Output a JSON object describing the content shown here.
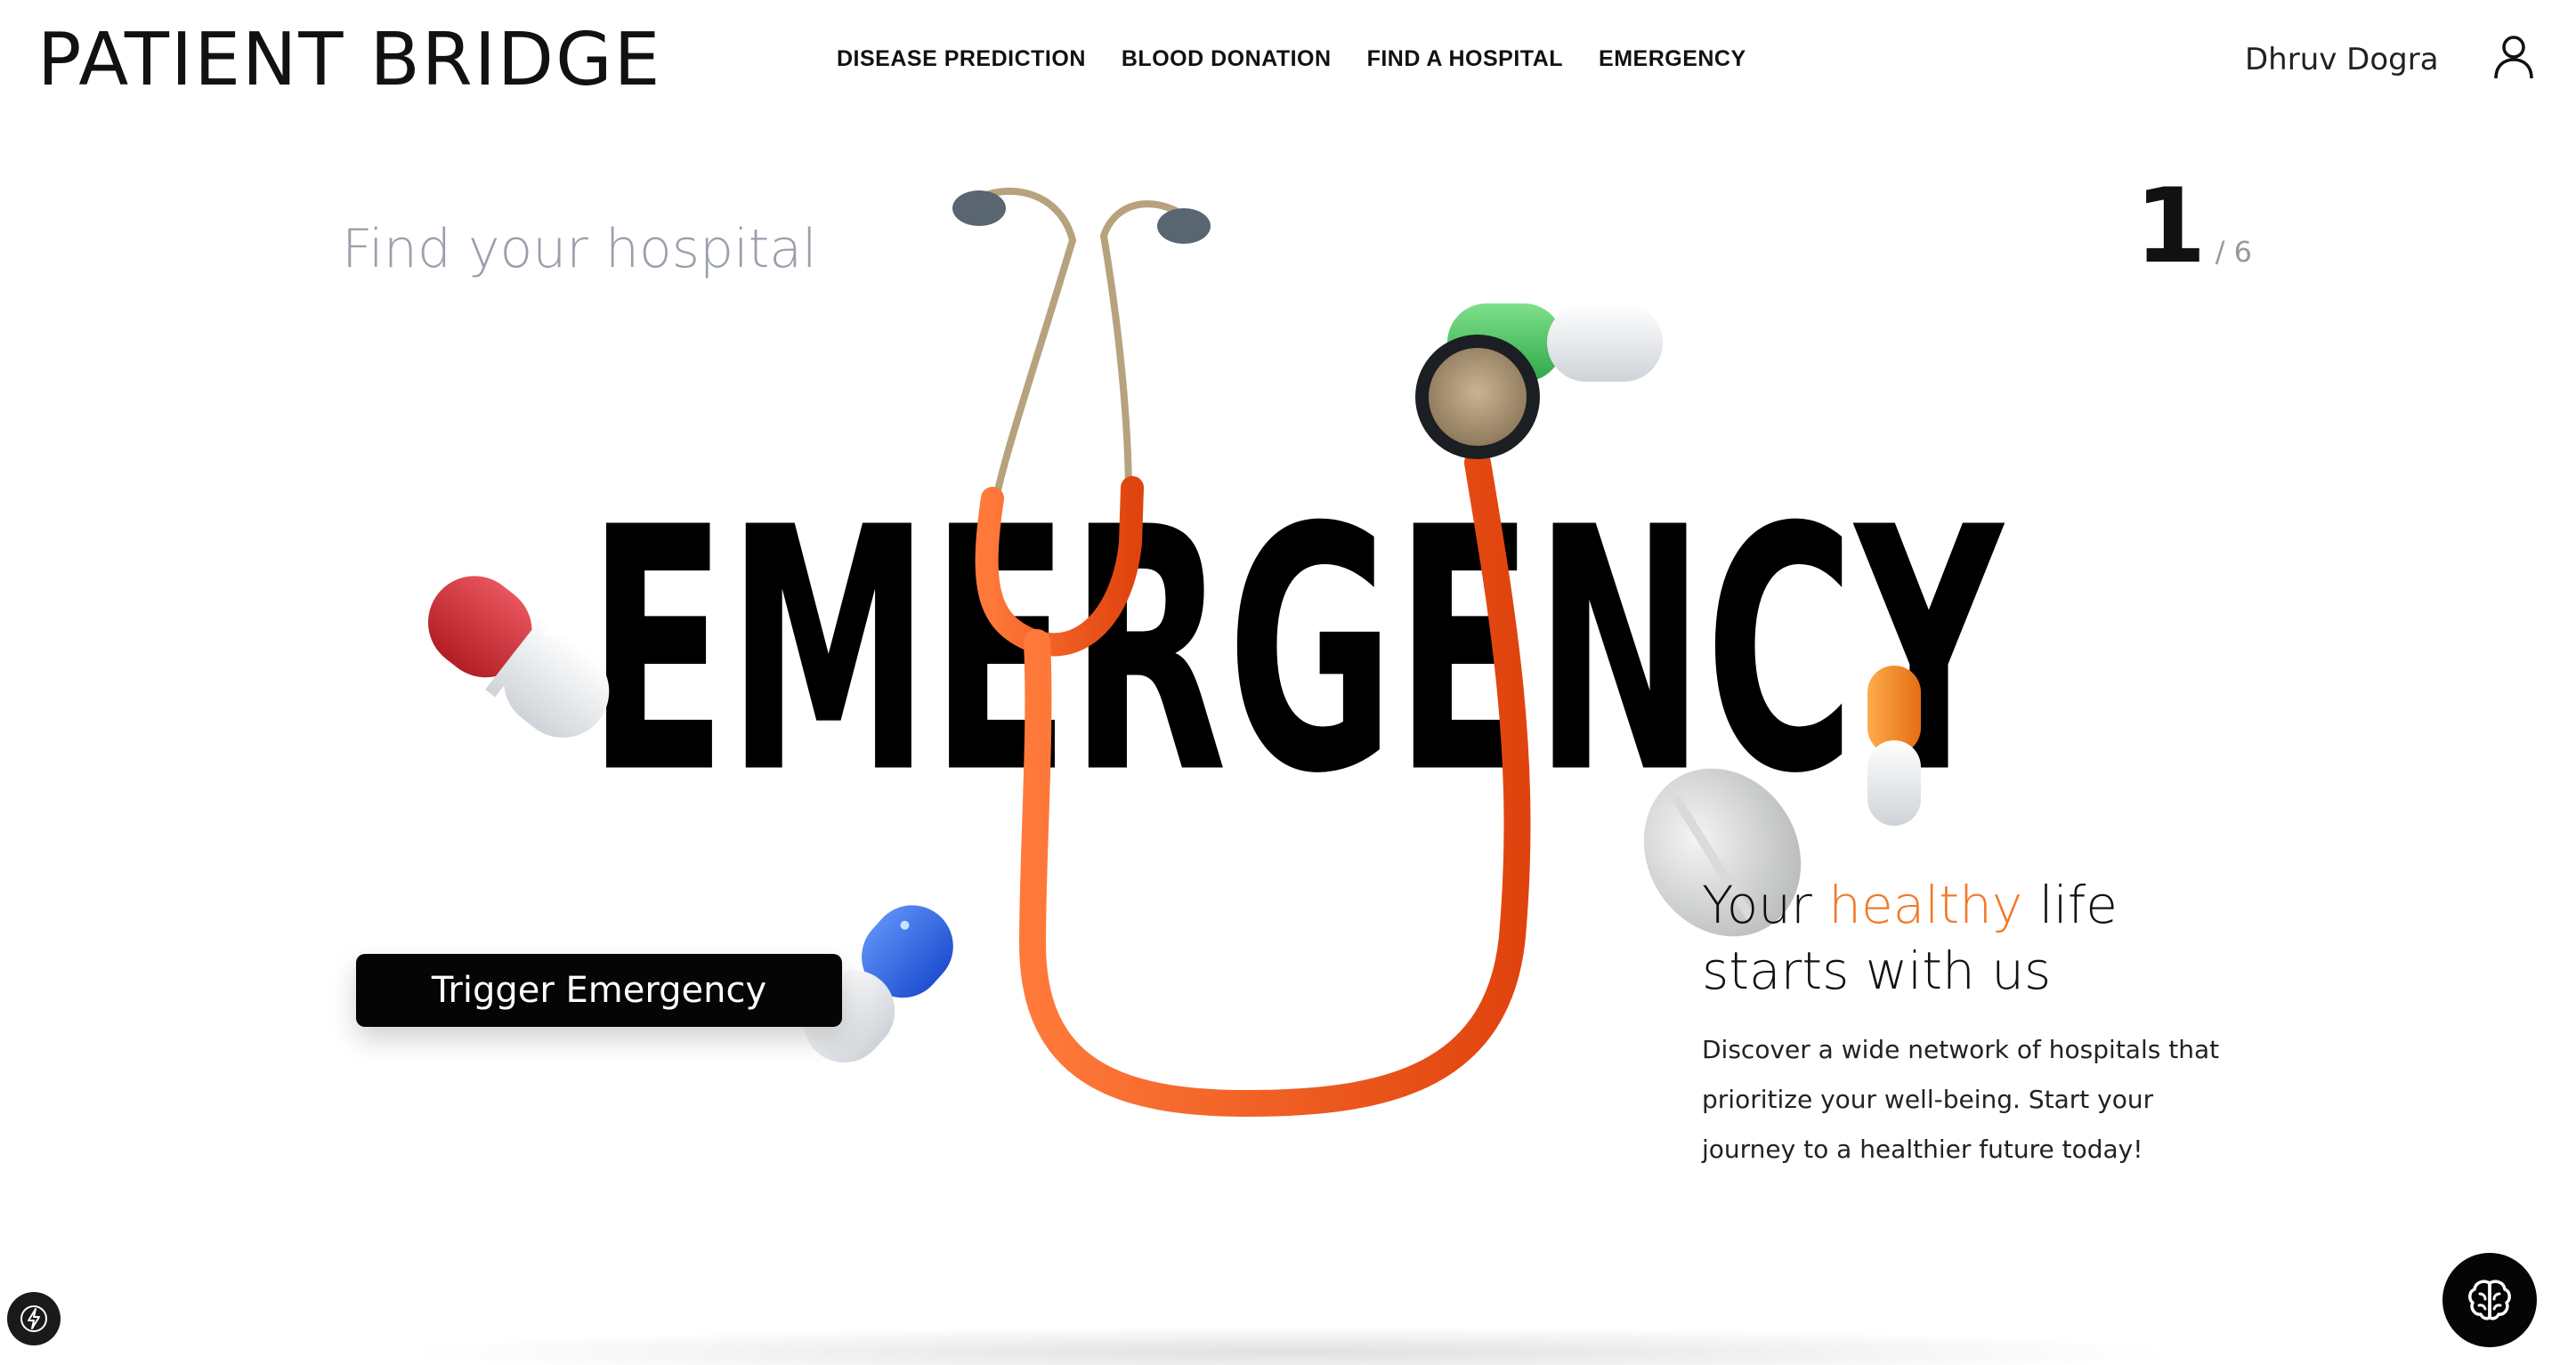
{
  "header": {
    "logo": "PATIENT BRIDGE",
    "nav": [
      {
        "label": "DISEASE PREDICTION"
      },
      {
        "label": "BLOOD DONATION"
      },
      {
        "label": "FIND A HOSPITAL"
      },
      {
        "label": "EMERGENCY"
      }
    ],
    "user_name": "Dhruv Dogra",
    "user_icon": "user-icon"
  },
  "hero": {
    "subtitle": "Find your hospital",
    "slide_current": "1",
    "slide_total": "/ 6",
    "headline": "EMERGENCY",
    "trigger_button": "Trigger Emergency",
    "tagline_part1": "Your ",
    "tagline_accent": "healthy",
    "tagline_part2": " life",
    "tagline_line2": "starts with us",
    "description": "Discover a wide network of hospitals that prioritize your well-being. Start your journey to a healthier future today!"
  },
  "floating": {
    "bolt_icon": "bolt-icon",
    "brain_icon": "brain-icon"
  },
  "colors": {
    "accent": "#f07a2a",
    "stethoscope": "#f2581c",
    "text": "#111111",
    "muted": "#9aa0ab",
    "button_bg": "#050505"
  }
}
